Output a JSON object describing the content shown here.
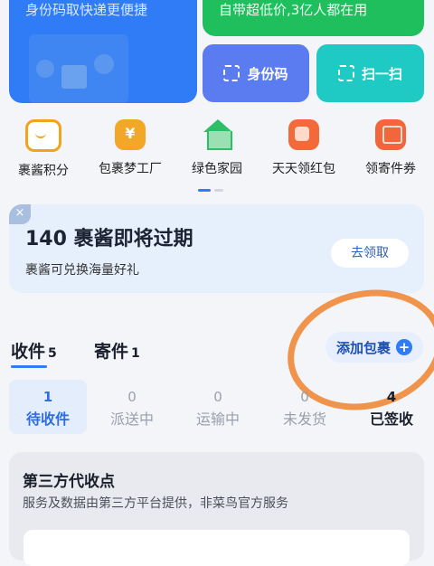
{
  "top": {
    "blue_desc": "身份码取快递更便捷",
    "green_desc": "自带超低价,3亿人都在用",
    "id_code": "身份码",
    "scan": "扫一扫"
  },
  "quick": [
    {
      "label": "裹酱积分",
      "icon": "smile-coin-icon"
    },
    {
      "label": "包裹梦工厂",
      "icon": "yen-coin-icon"
    },
    {
      "label": "绿色家园",
      "icon": "green-home-icon"
    },
    {
      "label": "天天领红包",
      "icon": "red-envelope-icon"
    },
    {
      "label": "领寄件券",
      "icon": "ticket-icon"
    }
  ],
  "banner": {
    "title": "140 裹酱即将过期",
    "subtitle": "裹酱可兑换海量好礼",
    "claim": "去领取",
    "close": "×"
  },
  "tabs": {
    "receive_label": "收件",
    "receive_count": "5",
    "send_label": "寄件",
    "send_count": "1",
    "add": "添加包裹"
  },
  "statuses": [
    {
      "count": "1",
      "label": "待收件"
    },
    {
      "count": "0",
      "label": "派送中"
    },
    {
      "count": "0",
      "label": "运输中"
    },
    {
      "count": "0",
      "label": "未发货"
    },
    {
      "count": "4",
      "label": "已签收"
    }
  ],
  "third_party": {
    "title": "第三方代收点",
    "desc": "服务及数据由第三方平台提供，非菜鸟官方服务"
  },
  "colors": {
    "accent": "#2f7cf6",
    "green": "#1fbf5e",
    "annotation": "#f08a3c"
  }
}
